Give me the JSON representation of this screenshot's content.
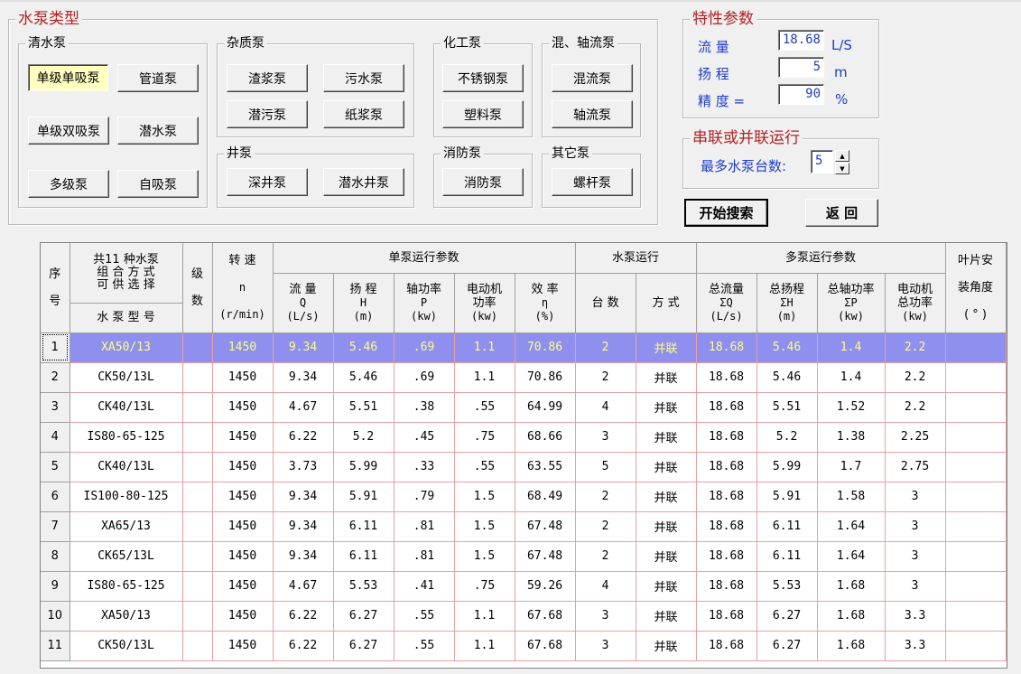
{
  "pump_types": {
    "title": "水泵类型",
    "clean_water": {
      "title": "清水泵",
      "buttons": [
        "单级单吸泵",
        "管道泵",
        "单级双吸泵",
        "潜水泵",
        "多级泵",
        "自吸泵"
      ]
    },
    "impurity": {
      "title": "杂质泵",
      "buttons": [
        "渣浆泵",
        "污水泵",
        "潜污泵",
        "纸浆泵"
      ]
    },
    "well": {
      "title": "井泵",
      "buttons": [
        "深井泵",
        "潜水井泵"
      ]
    },
    "chemical": {
      "title": "化工泵",
      "buttons": [
        "不锈钢泵",
        "塑料泵"
      ]
    },
    "fire": {
      "title": "消防泵",
      "buttons": [
        "消防泵"
      ]
    },
    "mixed_axial": {
      "title": "混、轴流泵",
      "buttons": [
        "混流泵",
        "轴流泵"
      ]
    },
    "other": {
      "title": "其它泵",
      "buttons": [
        "螺杆泵"
      ]
    },
    "selected": "单级单吸泵"
  },
  "params": {
    "title": "特性参数",
    "flow_label": "流  量",
    "flow_value": "18.68",
    "flow_unit": "L/S",
    "head_label": "扬  程",
    "head_value": "5",
    "head_unit": "m",
    "precision_label": "精  度 =",
    "precision_value": "90",
    "precision_unit": "%"
  },
  "series": {
    "title": "串联或并联运行",
    "max_label": "最多水泵台数:",
    "max_value": "5"
  },
  "actions": {
    "search": "开始搜索",
    "back": "返  回"
  },
  "table": {
    "headers": {
      "seq": [
        "序",
        "号"
      ],
      "combo": [
        "共11 种水泵",
        "组 合 方 式",
        "可 供 选 择"
      ],
      "model": "水 泵 型 号",
      "stage": [
        "级",
        "数"
      ],
      "speed": [
        "转  速",
        "n",
        "(r/min)"
      ],
      "single_group": "单泵运行参数",
      "flow": [
        "流  量",
        "Q",
        "(L/s)"
      ],
      "head": [
        "扬  程",
        "H",
        "(m)"
      ],
      "shaft": [
        "轴功率",
        "P",
        "(kw)"
      ],
      "motor": [
        "电动机",
        "功率",
        "(kw)"
      ],
      "eff": [
        "效  率",
        "η",
        "(%)"
      ],
      "run_group": "水泵运行",
      "count": "台  数",
      "mode": "方  式",
      "multi_group": "多泵运行参数",
      "total_flow": [
        "总流量",
        "ΣQ",
        "(L/s)"
      ],
      "total_head": [
        "总扬程",
        "ΣH",
        "(m)"
      ],
      "total_shaft": [
        "总轴功率",
        "ΣP",
        "(kw)"
      ],
      "motor_total": [
        "电动机",
        "总功率",
        "(kw)"
      ],
      "blade": [
        "叶片安",
        "装角度",
        "( ° )"
      ]
    },
    "rows": [
      [
        "1",
        "XA50/13",
        "",
        "1450",
        "9.34",
        "5.46",
        ".69",
        "1.1",
        "70.86",
        "2",
        "并联",
        "18.68",
        "5.46",
        "1.4",
        "2.2",
        ""
      ],
      [
        "2",
        "CK50/13L",
        "",
        "1450",
        "9.34",
        "5.46",
        ".69",
        "1.1",
        "70.86",
        "2",
        "并联",
        "18.68",
        "5.46",
        "1.4",
        "2.2",
        ""
      ],
      [
        "3",
        "CK40/13L",
        "",
        "1450",
        "4.67",
        "5.51",
        ".38",
        ".55",
        "64.99",
        "4",
        "并联",
        "18.68",
        "5.51",
        "1.52",
        "2.2",
        ""
      ],
      [
        "4",
        "IS80-65-125",
        "",
        "1450",
        "6.22",
        "5.2",
        ".45",
        ".75",
        "68.66",
        "3",
        "并联",
        "18.68",
        "5.2",
        "1.38",
        "2.25",
        ""
      ],
      [
        "5",
        "CK40/13L",
        "",
        "1450",
        "3.73",
        "5.99",
        ".33",
        ".55",
        "63.55",
        "5",
        "并联",
        "18.68",
        "5.99",
        "1.7",
        "2.75",
        ""
      ],
      [
        "6",
        "IS100-80-125",
        "",
        "1450",
        "9.34",
        "5.91",
        ".79",
        "1.5",
        "68.49",
        "2",
        "并联",
        "18.68",
        "5.91",
        "1.58",
        "3",
        ""
      ],
      [
        "7",
        "XA65/13",
        "",
        "1450",
        "9.34",
        "6.11",
        ".81",
        "1.5",
        "67.48",
        "2",
        "并联",
        "18.68",
        "6.11",
        "1.64",
        "3",
        ""
      ],
      [
        "8",
        "CK65/13L",
        "",
        "1450",
        "9.34",
        "6.11",
        ".81",
        "1.5",
        "67.48",
        "2",
        "并联",
        "18.68",
        "6.11",
        "1.64",
        "3",
        ""
      ],
      [
        "9",
        "IS80-65-125",
        "",
        "1450",
        "4.67",
        "5.53",
        ".41",
        ".75",
        "59.26",
        "4",
        "并联",
        "18.68",
        "5.53",
        "1.68",
        "3",
        ""
      ],
      [
        "10",
        "XA50/13",
        "",
        "1450",
        "6.22",
        "6.27",
        ".55",
        "1.1",
        "67.68",
        "3",
        "并联",
        "18.68",
        "6.27",
        "1.68",
        "3.3",
        ""
      ],
      [
        "11",
        "CK50/13L",
        "",
        "1450",
        "6.22",
        "6.27",
        ".55",
        "1.1",
        "67.68",
        "3",
        "并联",
        "18.68",
        "6.27",
        "1.68",
        "3.3",
        ""
      ]
    ],
    "selected_row": 0
  },
  "colors": {
    "selection_bg": "#8f8ff0",
    "selection_text": "#ffff80",
    "label_blue": "#1e3cc8",
    "title_red": "#b22222"
  }
}
